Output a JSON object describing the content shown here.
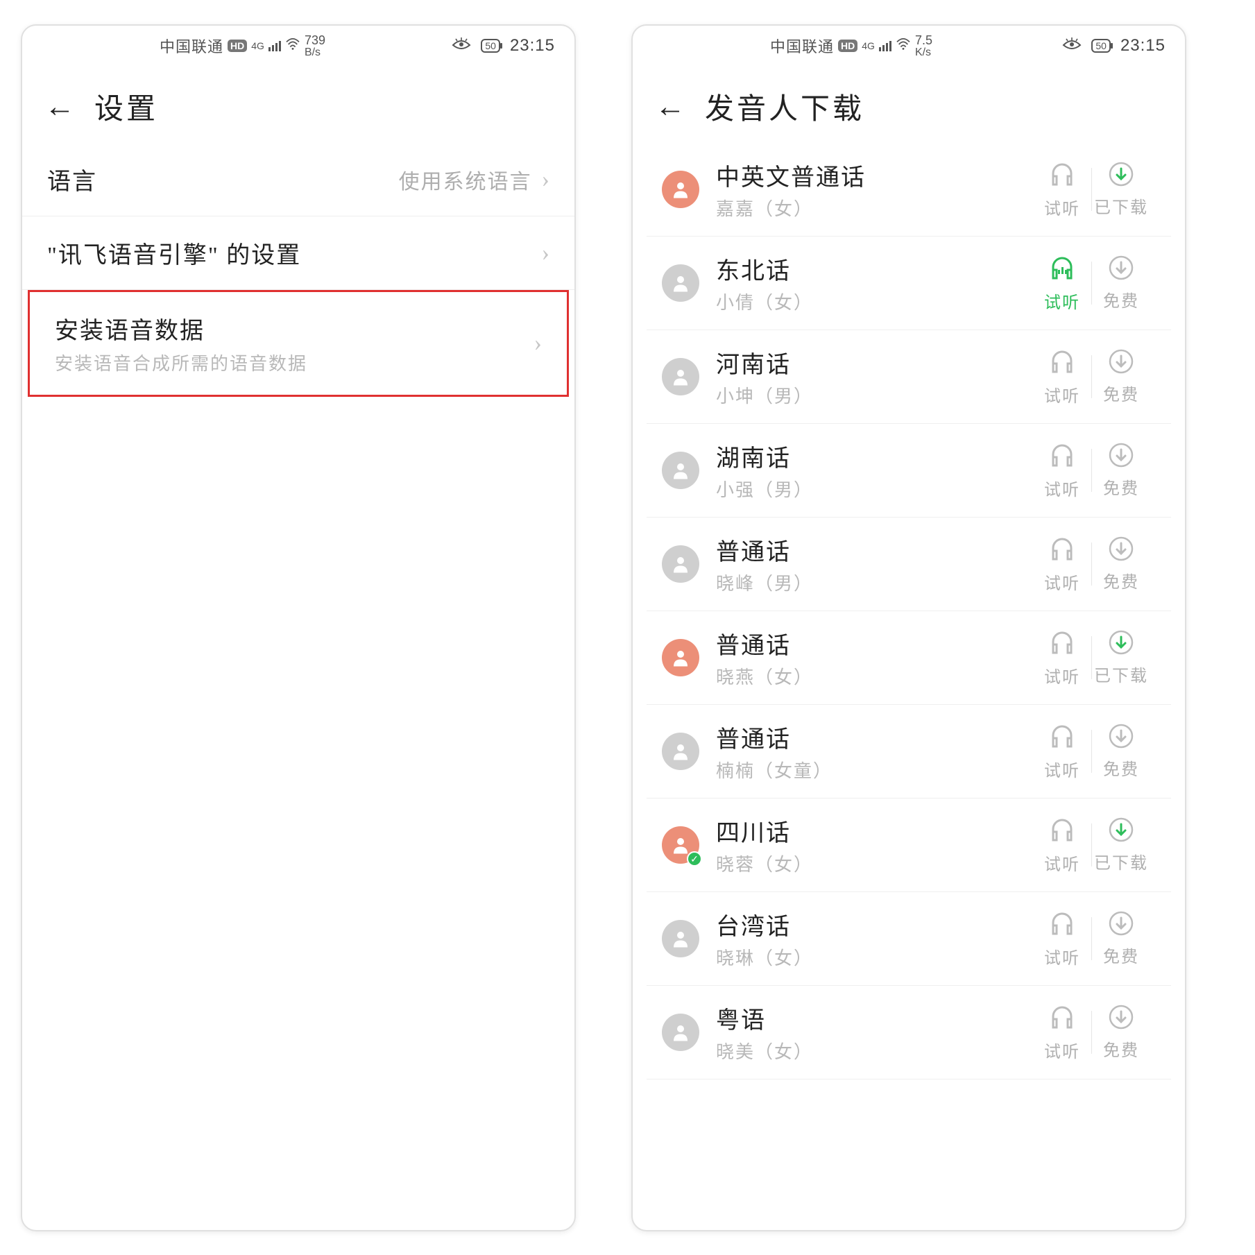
{
  "status": {
    "carrier": "中国联通",
    "hd": "HD",
    "net_gen": "4G",
    "time": "23:15",
    "battery": "50",
    "left_speed_top": "739",
    "left_speed_bot": "B/s",
    "right_speed_top": "7.5",
    "right_speed_bot": "K/s"
  },
  "left": {
    "title": "设置",
    "rows": {
      "lang_label": "语言",
      "lang_value": "使用系统语言",
      "engine_label": "\"讯飞语音引擎\" 的设置",
      "install_title": "安装语音数据",
      "install_sub": "安装语音合成所需的语音数据"
    }
  },
  "right": {
    "title": "发音人下载",
    "listen": "试听",
    "free": "免费",
    "downloaded": "已下载",
    "voices": [
      {
        "title": "中英文普通话",
        "sub": "嘉嘉（女）",
        "avatar": "coral",
        "state": "downloaded",
        "listening": false,
        "check": false
      },
      {
        "title": "东北话",
        "sub": "小倩（女）",
        "avatar": "gray",
        "state": "free",
        "listening": true,
        "check": false
      },
      {
        "title": "河南话",
        "sub": "小坤（男）",
        "avatar": "gray",
        "state": "free",
        "listening": false,
        "check": false
      },
      {
        "title": "湖南话",
        "sub": "小强（男）",
        "avatar": "gray",
        "state": "free",
        "listening": false,
        "check": false
      },
      {
        "title": "普通话",
        "sub": "晓峰（男）",
        "avatar": "gray",
        "state": "free",
        "listening": false,
        "check": false
      },
      {
        "title": "普通话",
        "sub": "晓燕（女）",
        "avatar": "coral",
        "state": "downloaded",
        "listening": false,
        "check": false
      },
      {
        "title": "普通话",
        "sub": "楠楠（女童）",
        "avatar": "gray",
        "state": "free",
        "listening": false,
        "check": false
      },
      {
        "title": "四川话",
        "sub": "晓蓉（女）",
        "avatar": "coral",
        "state": "downloaded",
        "listening": false,
        "check": true
      },
      {
        "title": "台湾话",
        "sub": "晓琳（女）",
        "avatar": "gray",
        "state": "free",
        "listening": false,
        "check": false
      },
      {
        "title": "粤语",
        "sub": "晓美（女）",
        "avatar": "gray",
        "state": "free",
        "listening": false,
        "check": false
      }
    ]
  }
}
